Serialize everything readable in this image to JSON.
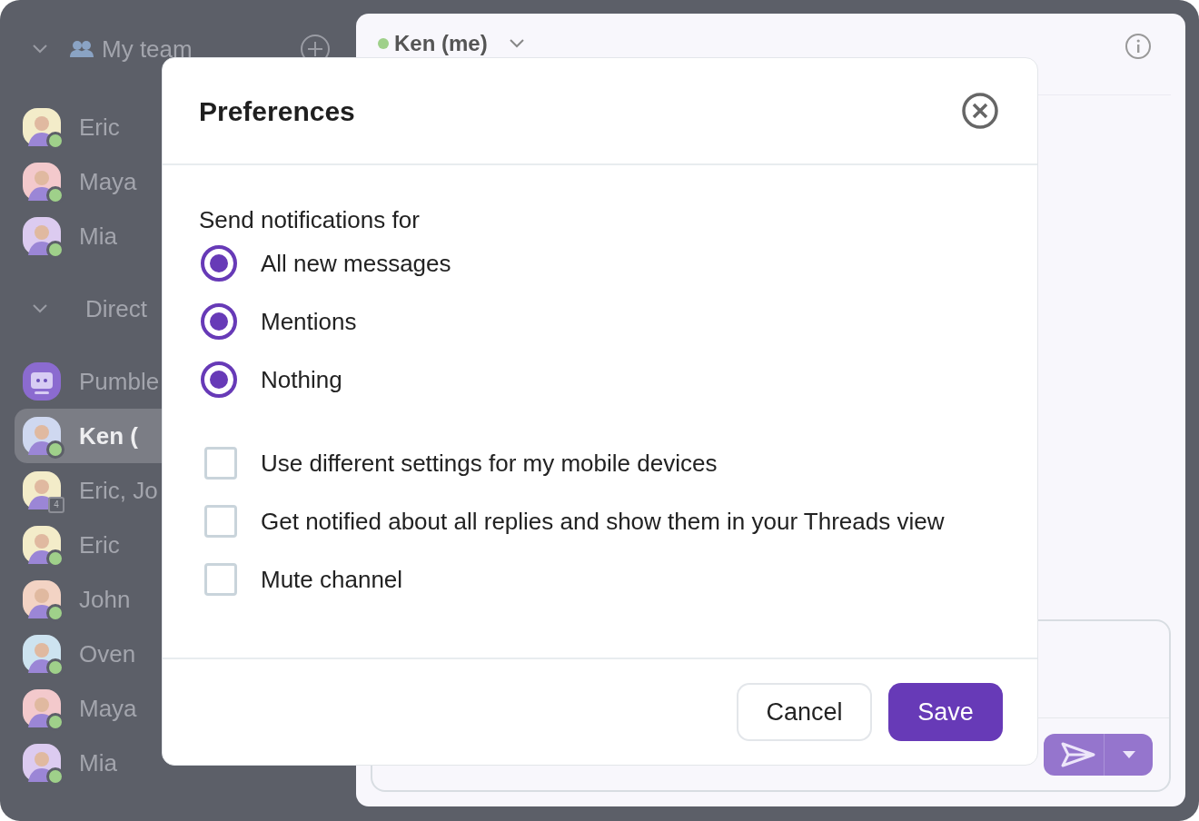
{
  "sidebar": {
    "sections": [
      {
        "title": "My team",
        "expanded": true,
        "add_button": true,
        "items": [
          {
            "name": "Eric",
            "kind": "person",
            "color": "#f3ecc9",
            "selected": false
          },
          {
            "name": "Maya",
            "kind": "person",
            "color": "#f3c9cc",
            "selected": false
          },
          {
            "name": "Mia",
            "kind": "person",
            "color": "#dccbf0",
            "selected": false
          }
        ]
      },
      {
        "title": "Direct",
        "expanded": true,
        "add_button": false,
        "items": [
          {
            "name": "Pumble",
            "kind": "bot",
            "color": "#8b6bd0",
            "selected": false
          },
          {
            "name": "Ken (",
            "kind": "person",
            "color": "#cfd8f0",
            "selected": true
          },
          {
            "name": "Eric, Jo",
            "kind": "group",
            "count": "4",
            "color": "#f3ecc9",
            "selected": false
          },
          {
            "name": "Eric",
            "kind": "person",
            "color": "#f3ecc9",
            "selected": false
          },
          {
            "name": "John",
            "kind": "person",
            "color": "#f3d3c4",
            "selected": false
          },
          {
            "name": "Oven",
            "kind": "person",
            "color": "#cde3f0",
            "selected": false
          },
          {
            "name": "Maya",
            "kind": "person",
            "color": "#f3c9cc",
            "selected": false
          },
          {
            "name": "Mia",
            "kind": "person",
            "color": "#dccbf0",
            "selected": false
          }
        ]
      }
    ]
  },
  "conversation": {
    "title": "Ken (me)",
    "online": true
  },
  "dialog": {
    "title": "Preferences",
    "group_label": "Send notifications for",
    "radios": [
      {
        "label": "All new messages",
        "selected": true
      },
      {
        "label": "Mentions",
        "selected": true
      },
      {
        "label": "Nothing",
        "selected": true
      }
    ],
    "checkboxes": [
      {
        "label": "Use different settings for my mobile devices",
        "checked": false
      },
      {
        "label": "Get notified about all replies and show them in your Threads view",
        "checked": false
      },
      {
        "label": "Mute channel",
        "checked": false
      }
    ],
    "buttons": [
      {
        "label": "Cancel",
        "kind": "secondary"
      },
      {
        "label": "Save",
        "kind": "primary"
      }
    ]
  }
}
